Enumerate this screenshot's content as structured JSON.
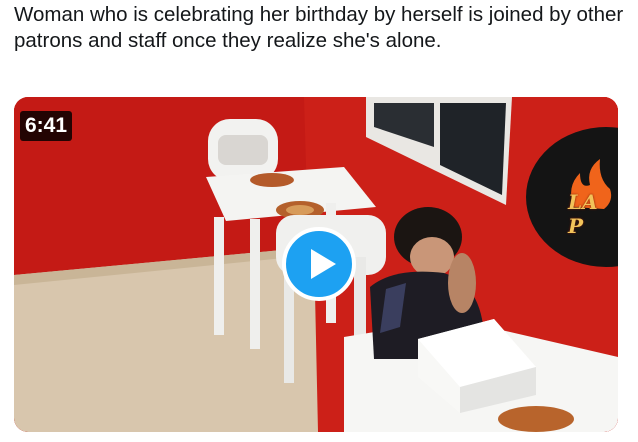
{
  "tweet": {
    "text": "Woman who is celebrating her birthday by herself is joined by other patrons and staff once they realize she's alone."
  },
  "video": {
    "duration": "6:41",
    "play_icon": "play-icon",
    "sign_text": "LA P"
  },
  "colors": {
    "accent": "#1da1f2",
    "wall": "#c9211c",
    "text": "#14171a"
  }
}
